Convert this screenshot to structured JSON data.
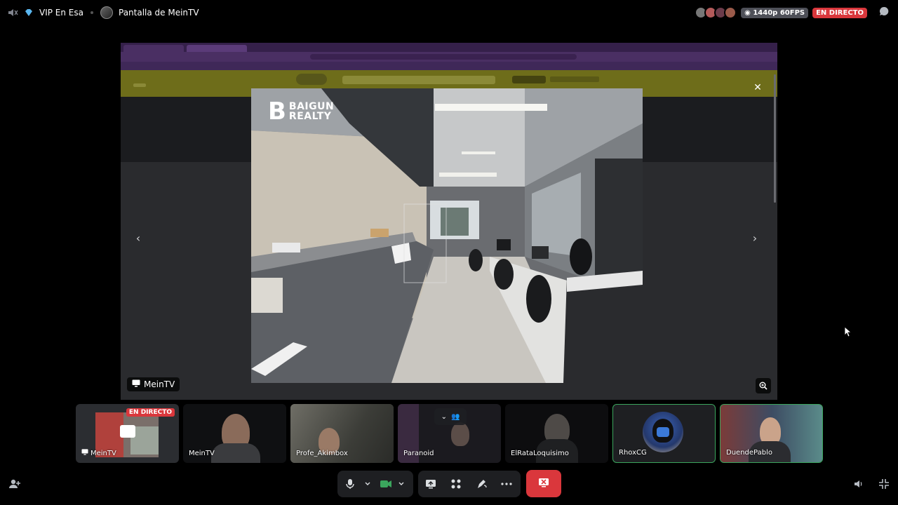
{
  "topbar": {
    "server_name": "VIP En Esa",
    "channel_title": "Pantalla de MeinTV",
    "quality": "1440p 60FPS",
    "live_label": "EN DIRECTO",
    "colors": {
      "live": "#da373c",
      "badge": "#4e5058",
      "server_gem": "#5ab7f0"
    }
  },
  "stage": {
    "streamer_tag": "MeinTV",
    "photo_brand_mark": "B",
    "photo_brand_line1": "BAIGUN",
    "photo_brand_line2": "REALTY",
    "icons": {
      "close": "close-icon",
      "prev": "chevron-left-icon",
      "next": "chevron-right-icon",
      "zoom": "zoom-in-icon"
    }
  },
  "participants": [
    {
      "name": "MeinTV",
      "live": "EN DIRECTO",
      "type": "screen"
    },
    {
      "name": "MeinTV",
      "type": "camera"
    },
    {
      "name": "Profe_Akimbox",
      "type": "camera"
    },
    {
      "name": "Paranoid",
      "type": "camera"
    },
    {
      "name": "ElRataLoquisimo",
      "type": "camera"
    },
    {
      "name": "RhoxCG",
      "type": "camera",
      "speaking": true
    },
    {
      "name": "DuendePablo",
      "type": "camera",
      "speaking": true
    }
  ],
  "controls": {
    "mic": "microphone-icon",
    "camera": "video-camera-icon",
    "screen_share": "screen-share-icon",
    "activities": "activities-icon",
    "soundboard": "soundboard-icon",
    "more": "more-icon",
    "disconnect": "end-call-icon",
    "accent_green": "#3ba55d",
    "disconnect_color": "#da373c"
  }
}
